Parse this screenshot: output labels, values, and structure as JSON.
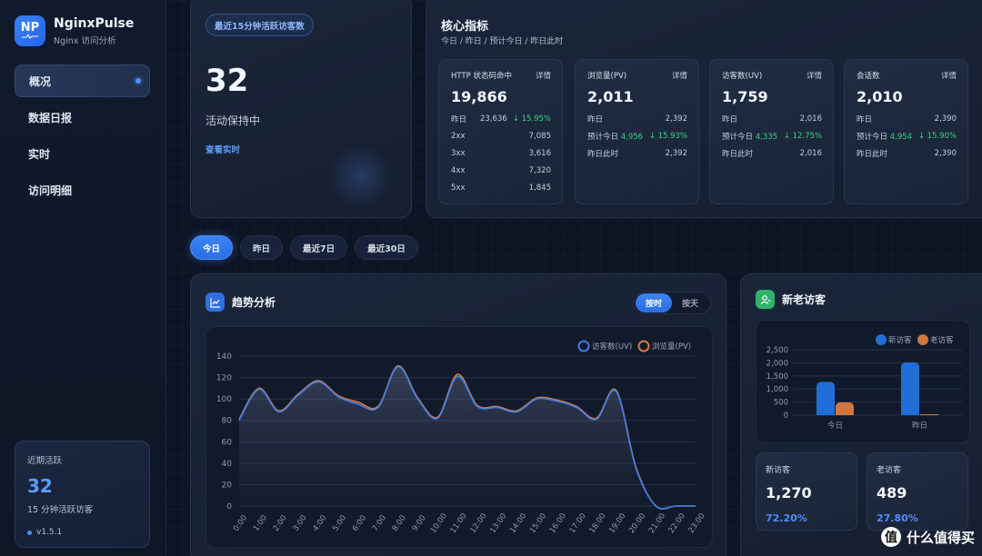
{
  "brand": {
    "logo": "NP",
    "title": "NginxPulse",
    "subtitle": "Nginx 访问分析"
  },
  "sidebar": {
    "items": [
      {
        "label": "概况",
        "active": true
      },
      {
        "label": "数据日报"
      },
      {
        "label": "实时"
      },
      {
        "label": "访问明细"
      }
    ],
    "recent": {
      "label": "近期活跃",
      "value": "32",
      "sub": "15 分钟活跃访客",
      "version": "v1.5.1"
    }
  },
  "active": {
    "chip": "最近15分钟活跃访客数",
    "value": "32",
    "status": "活动保持中",
    "link": "查看实时"
  },
  "metrics": {
    "title": "核心指标",
    "subtitle": "今日 / 昨日 / 预计今日 / 昨日此时",
    "detail": "详情",
    "http": {
      "title": "HTTP 状态码命中",
      "value": "19,866",
      "yesterday_label": "昨日",
      "yesterday": "23,636",
      "change": "↓ 15.95%",
      "codes": [
        {
          "code": "2xx",
          "count": "7,085"
        },
        {
          "code": "3xx",
          "count": "3,616"
        },
        {
          "code": "4xx",
          "count": "7,320"
        },
        {
          "code": "5xx",
          "count": "1,845"
        }
      ]
    },
    "boxes": [
      {
        "title": "浏览量(PV)",
        "value": "2,011",
        "yesterday": "2,392",
        "forecast": "4,956",
        "change": "↓ 15.93%",
        "same_time": "2,392"
      },
      {
        "title": "访客数(UV)",
        "value": "1,759",
        "yesterday": "2,016",
        "forecast": "4,335",
        "change": "↓ 12.75%",
        "same_time": "2,016"
      },
      {
        "title": "会话数",
        "value": "2,010",
        "yesterday": "2,390",
        "forecast": "4,954",
        "change": "↓ 15.90%",
        "same_time": "2,390"
      }
    ],
    "labels": {
      "yesterday": "昨日",
      "forecast": "预计今日",
      "same_time": "昨日此时"
    }
  },
  "tabs": [
    {
      "label": "今日",
      "active": true
    },
    {
      "label": "昨日"
    },
    {
      "label": "最近7日"
    },
    {
      "label": "最近30日"
    }
  ],
  "trend": {
    "title": "趋势分析",
    "seg_on": "按时",
    "seg_off": "按天"
  },
  "visitors": {
    "title": "新老访客",
    "new_label": "新访客",
    "new_value": "1,270",
    "new_pct": "72.20%",
    "old_label": "老访客",
    "old_value": "489",
    "old_pct": "27.80%"
  },
  "watermark": {
    "symbol": "值",
    "text": "什么值得买"
  },
  "colors": {
    "accent": "#3b82f6",
    "uv": "#3b7de8",
    "pv": "#d9783f",
    "up": "#37d67a",
    "new": "#1f6fd6",
    "old": "#d0773f"
  },
  "chart_data": [
    {
      "type": "line",
      "title": "",
      "x": [
        "0:00",
        "1:00",
        "2:00",
        "3:00",
        "4:00",
        "5:00",
        "6:00",
        "7:00",
        "8:00",
        "9:00",
        "10:00",
        "11:00",
        "12:00",
        "13:00",
        "14:00",
        "15:00",
        "16:00",
        "17:00",
        "18:00",
        "19:00",
        "20:00",
        "21:00",
        "22:00",
        "23:00"
      ],
      "series": [
        {
          "name": "访客数(UV)",
          "values": [
            80,
            109,
            88,
            104,
            116,
            102,
            95,
            92,
            130,
            100,
            82,
            121,
            93,
            92,
            88,
            100,
            98,
            92,
            81,
            107,
            35,
            0,
            0,
            0
          ]
        },
        {
          "name": "浏览量(PV)",
          "values": [
            81,
            110,
            89,
            105,
            117,
            103,
            97,
            93,
            131,
            101,
            83,
            123,
            94,
            93,
            89,
            101,
            99,
            93,
            82,
            108,
            36,
            0,
            0,
            0
          ]
        }
      ],
      "ylim": [
        0,
        140
      ],
      "yticks": [
        0,
        20,
        40,
        60,
        80,
        100,
        120,
        140
      ],
      "grid": true,
      "legend": "top-right"
    },
    {
      "type": "bar",
      "title": "",
      "categories": [
        "今日",
        "昨日"
      ],
      "series": [
        {
          "name": "新访客",
          "values": [
            1270,
            2020
          ]
        },
        {
          "name": "老访客",
          "values": [
            489,
            20
          ]
        }
      ],
      "ylim": [
        0,
        2500
      ],
      "yticks": [
        0,
        500,
        1000,
        1500,
        2000,
        2500
      ],
      "yticklabels": [
        "0",
        "500",
        "1,000",
        "1,500",
        "2,000",
        "2,500"
      ],
      "legend": "top-right"
    }
  ]
}
